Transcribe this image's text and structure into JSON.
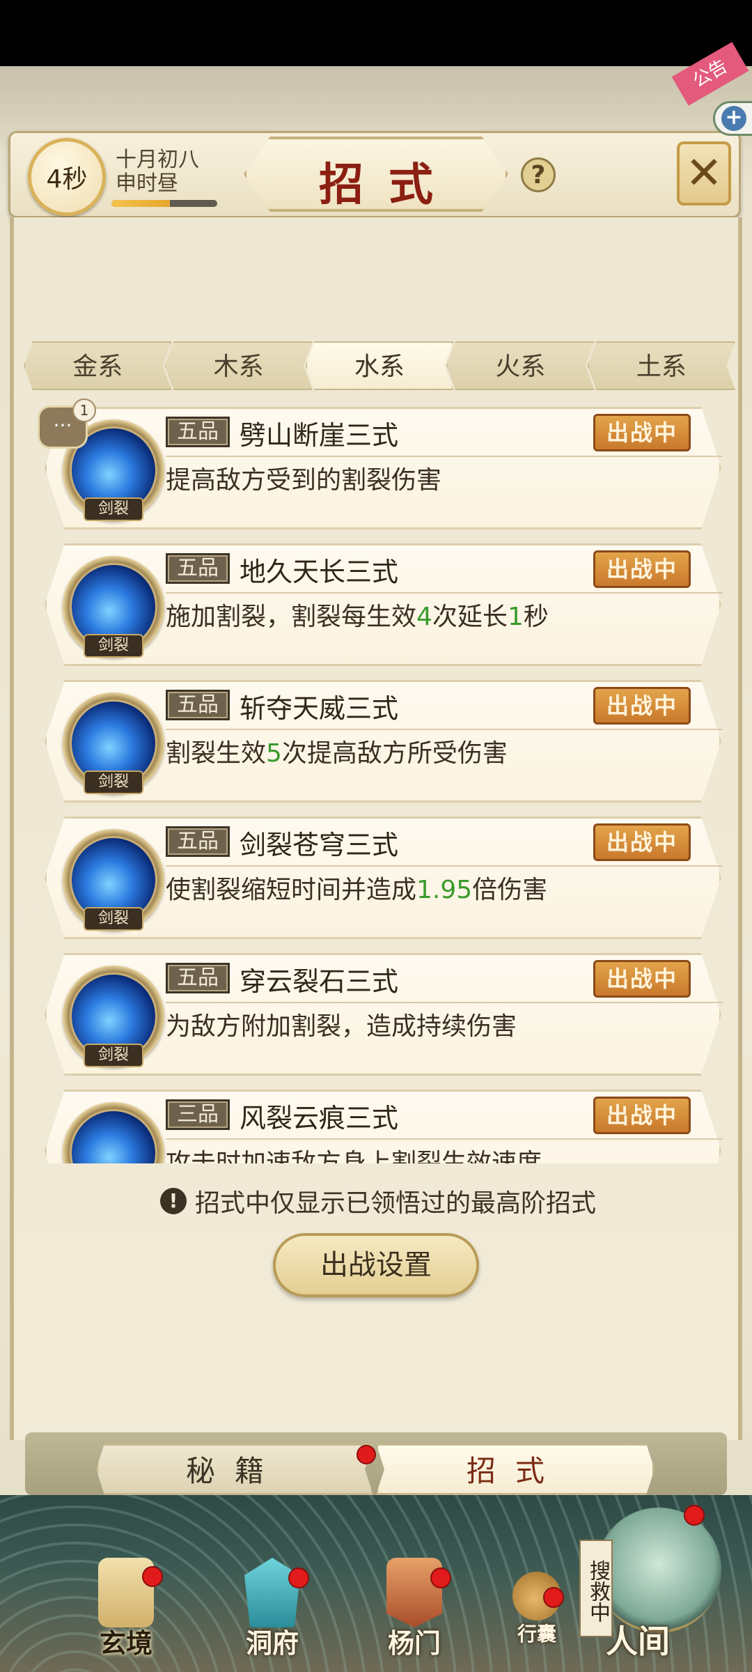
{
  "header": {
    "timer": "4秒",
    "date_line1": "十月初八",
    "date_line2": "申时昼",
    "timer_progress": 0.55,
    "title": "招式",
    "help_label": "?",
    "corner_tag": "公告"
  },
  "element_tabs": [
    {
      "label": "金系",
      "active": false
    },
    {
      "label": "木系",
      "active": false
    },
    {
      "label": "水系",
      "active": true
    },
    {
      "label": "火系",
      "active": false
    },
    {
      "label": "土系",
      "active": false
    }
  ],
  "chat": {
    "badge_count": "1"
  },
  "skills": [
    {
      "grade": "五品",
      "name": "劈山断崖三式",
      "status": "出战中",
      "tag": "剑裂",
      "desc": [
        {
          "t": "提高敌方受到的割裂伤害",
          "hl": false
        }
      ]
    },
    {
      "grade": "五品",
      "name": "地久天长三式",
      "status": "出战中",
      "tag": "剑裂",
      "desc": [
        {
          "t": "施加割裂，割裂每生效",
          "hl": false
        },
        {
          "t": "4",
          "hl": true
        },
        {
          "t": "次延长",
          "hl": false
        },
        {
          "t": "1",
          "hl": true
        },
        {
          "t": "秒",
          "hl": false
        }
      ]
    },
    {
      "grade": "五品",
      "name": "斩夺天威三式",
      "status": "出战中",
      "tag": "剑裂",
      "desc": [
        {
          "t": "割裂生效",
          "hl": false
        },
        {
          "t": "5",
          "hl": true
        },
        {
          "t": "次提高敌方所受伤害",
          "hl": false
        }
      ]
    },
    {
      "grade": "五品",
      "name": "剑裂苍穹三式",
      "status": "出战中",
      "tag": "剑裂",
      "desc": [
        {
          "t": "使割裂缩短时间并造成",
          "hl": false
        },
        {
          "t": "1.95",
          "hl": true
        },
        {
          "t": "倍伤害",
          "hl": false
        }
      ]
    },
    {
      "grade": "五品",
      "name": "穿云裂石三式",
      "status": "出战中",
      "tag": "剑裂",
      "desc": [
        {
          "t": "为敌方附加割裂，造成持续伤害",
          "hl": false
        }
      ]
    },
    {
      "grade": "三品",
      "name": "风裂云痕三式",
      "status": "出战中",
      "tag": "剑裂",
      "desc": [
        {
          "t": "攻击时加速敌方身上割裂生效速度",
          "hl": false
        }
      ]
    }
  ],
  "hint": {
    "icon": "!",
    "text": "招式中仅显示已领悟过的最高阶招式"
  },
  "deploy_button": "出战设置",
  "section_tabs": {
    "miji": "秘籍",
    "zhaoshi": "招式",
    "active": "zhaoshi"
  },
  "bottom_nav": {
    "items": [
      {
        "key": "xuanjing",
        "label": "玄境",
        "active": true
      },
      {
        "key": "dongfu",
        "label": "洞府",
        "active": false
      },
      {
        "key": "yangmen",
        "label": "杨门",
        "active": false
      },
      {
        "key": "xingnang",
        "label": "行囊",
        "active": false
      }
    ],
    "renjian": "人间",
    "rescue_tag": "搜救中"
  },
  "colors": {
    "accent_red": "#8b1f12",
    "status_orange": "#c9792c",
    "highlight_green": "#3a9a2c",
    "notify_red": "#e11b1b"
  }
}
